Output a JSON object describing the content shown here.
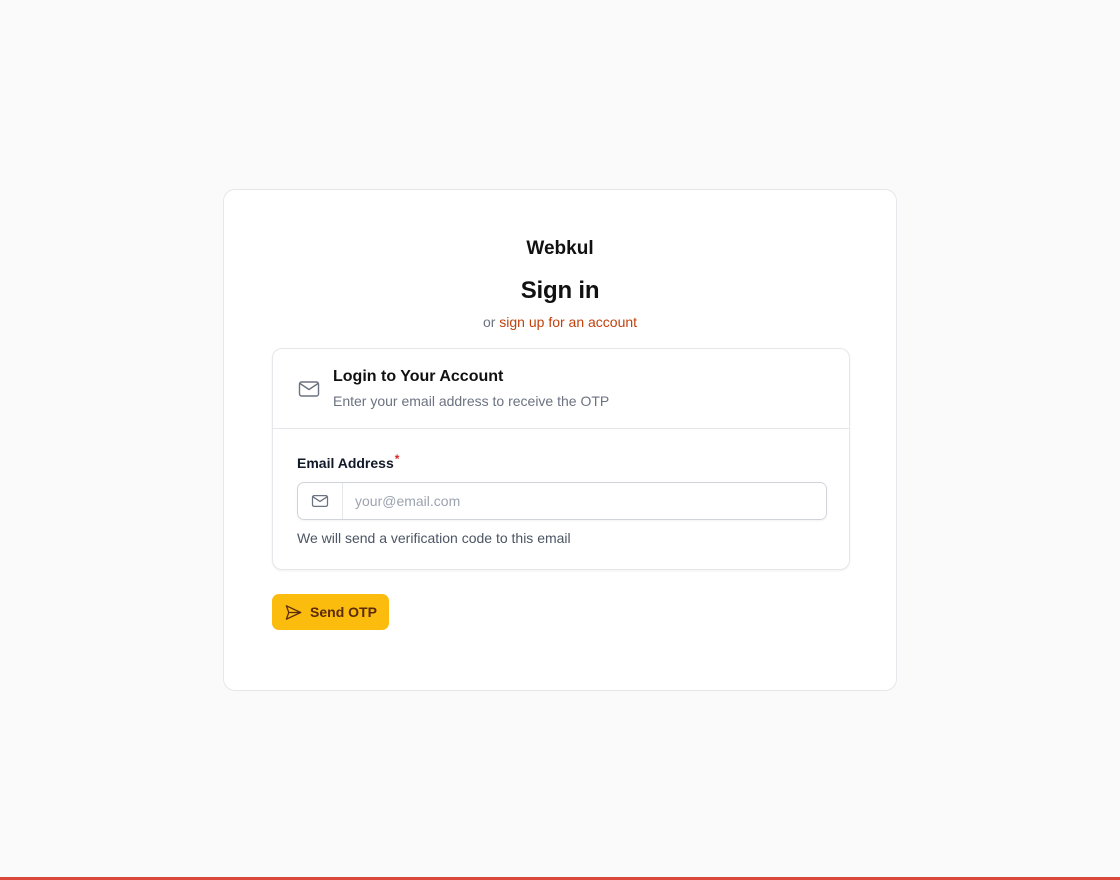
{
  "brand": {
    "name": "Webkul"
  },
  "header": {
    "title": "Sign in",
    "subtitle_prefix": "or",
    "signup_link": "sign up for an account"
  },
  "panel": {
    "icon": "mail-icon",
    "title": "Login to Your Account",
    "description": "Enter your email address to receive the OTP"
  },
  "form": {
    "email_label": "Email Address",
    "required_marker": "*",
    "email_placeholder": "your@email.com",
    "email_value": "",
    "email_icon": "mail-icon",
    "help_text": "We will send a verification code to this email"
  },
  "actions": {
    "send_label": "Send OTP",
    "send_icon": "send-icon"
  },
  "colors": {
    "accent_button": "#fbbc0e",
    "link": "#c2410c",
    "required": "#dc2626",
    "bottom_bar": "#d9483b",
    "background": "#fafafa"
  }
}
